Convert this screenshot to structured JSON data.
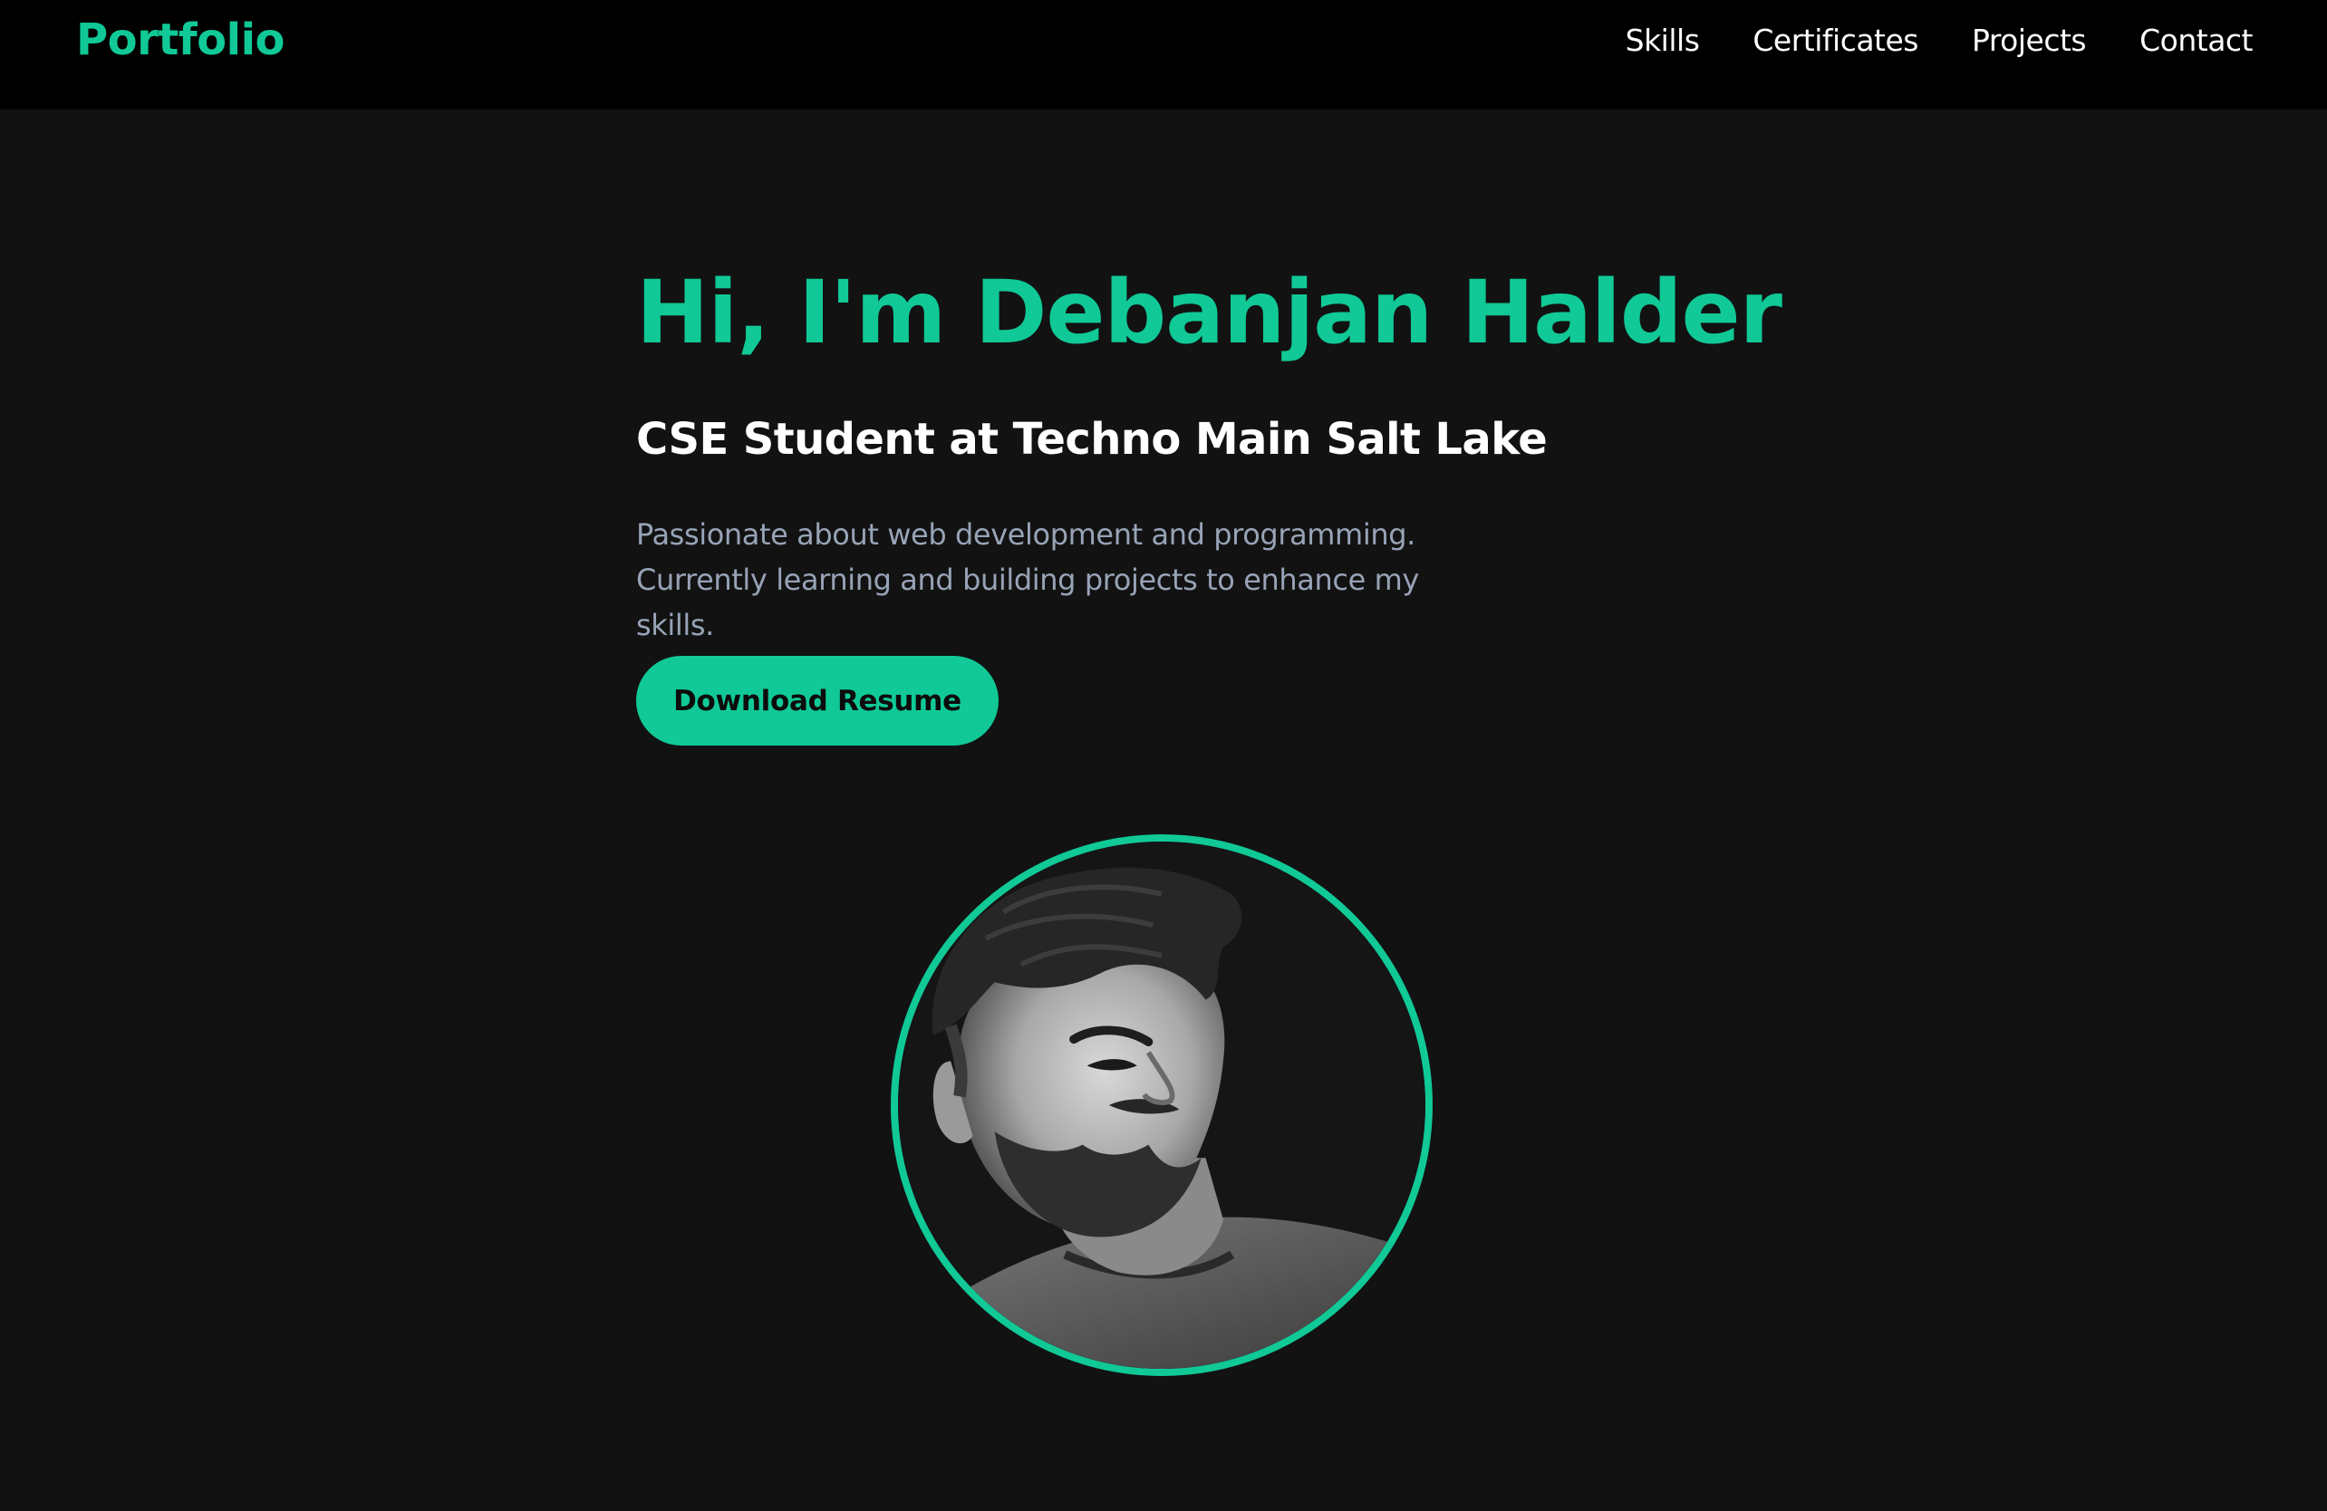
{
  "nav": {
    "brand": "Portfolio",
    "links": [
      "Skills",
      "Certificates",
      "Projects",
      "Contact"
    ]
  },
  "hero": {
    "title": "Hi, I'm Debanjan Halder",
    "subtitle": "CSE Student at Techno Main Salt Lake",
    "description": "Passionate about web development and programming. Currently learning and building projects to enhance my skills.",
    "button_label": "Download Resume"
  },
  "avatar": {
    "icon": "profile-photo"
  },
  "colors": {
    "accent": "#10c996",
    "nav_bg": "#000000",
    "page_bg": "#121212",
    "desc_text": "#97a3b6"
  }
}
